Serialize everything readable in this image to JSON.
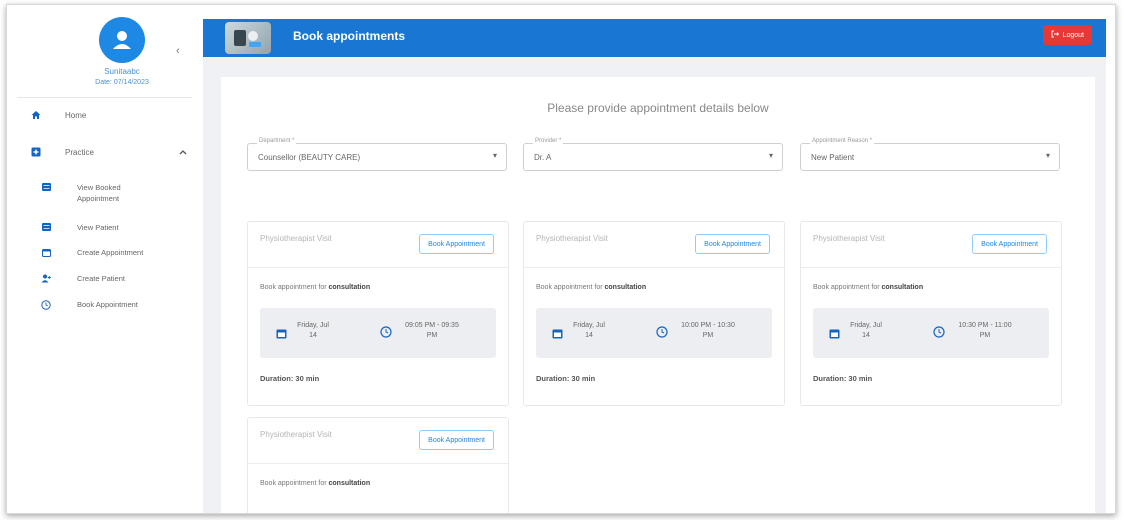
{
  "header": {
    "title": "Book appointments",
    "logout_label": "Logout"
  },
  "user": {
    "name": "Sunitaabc",
    "date": "Date: 07/14/2023"
  },
  "sidebar": {
    "home": "Home",
    "practice": "Practice",
    "sub_items": [
      {
        "label": "View Booked Appointment",
        "icon": "list-icon"
      },
      {
        "label": "View Patient",
        "icon": "list-icon"
      },
      {
        "label": "Create Appointment",
        "icon": "calendar-icon"
      },
      {
        "label": "Create Patient",
        "icon": "person-add-icon"
      },
      {
        "label": "Book Appointment",
        "icon": "clock-icon"
      }
    ]
  },
  "form": {
    "title": "Please provide appointment details below",
    "department": {
      "label": "Department *",
      "value": "Counsellor (BEAUTY CARE)"
    },
    "provider": {
      "label": "Provider *",
      "value": "Dr. A"
    },
    "reason": {
      "label": "Appointment Reason *",
      "value": "New Patient"
    }
  },
  "cards": [
    {
      "name": "Physiotherapist Visit",
      "button": "Book Appointment",
      "desc_prefix": "Book appointment for",
      "desc_bold": "consultation",
      "date": "Friday, Jul 14",
      "time": "09:05 PM - 09:35 PM",
      "duration": "Duration: 30 min"
    },
    {
      "name": "Physiotherapist Visit",
      "button": "Book Appointment",
      "desc_prefix": "Book appointment for",
      "desc_bold": "consultation",
      "date": "Friday, Jul 14",
      "time": "10:00 PM - 10:30 PM",
      "duration": "Duration: 30 min"
    },
    {
      "name": "Physiotherapist Visit",
      "button": "Book Appointment",
      "desc_prefix": "Book appointment for",
      "desc_bold": "consultation",
      "date": "Friday, Jul 14",
      "time": "10:30 PM - 11:00 PM",
      "duration": "Duration: 30 min"
    },
    {
      "name": "Physiotherapist Visit",
      "button": "Book Appointment",
      "desc_prefix": "Book appointment for",
      "desc_bold": "consultation",
      "date": "",
      "time": "",
      "duration": ""
    }
  ],
  "colors": {
    "primary": "#1976d2",
    "logout": "#e53935",
    "accent": "#1e88e5"
  }
}
